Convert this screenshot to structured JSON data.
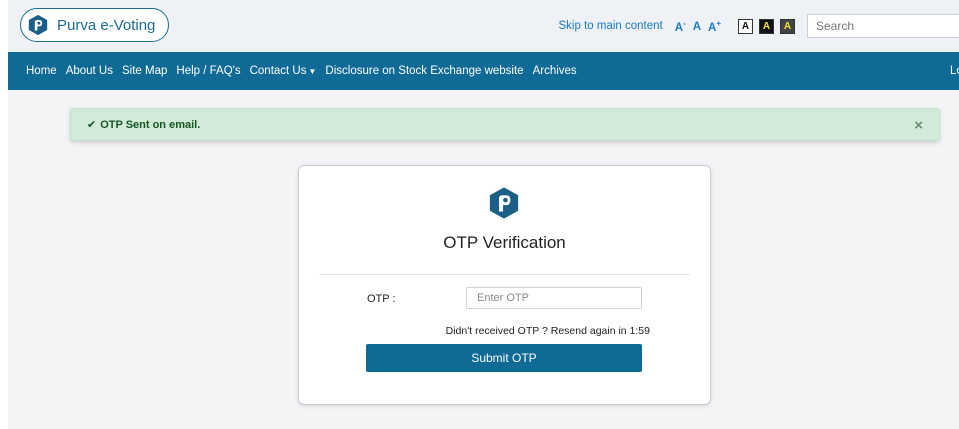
{
  "header": {
    "brand": "Purva e-Voting",
    "skip_link": "Skip to main content",
    "font_controls": {
      "decrease": "A",
      "decrease_sup": "-",
      "normal": "A",
      "increase": "A",
      "increase_sup": "+"
    },
    "contrast_options": [
      "A",
      "A",
      "A"
    ],
    "search_placeholder": "Search"
  },
  "nav": {
    "items": [
      "Home",
      "About Us",
      "Site Map",
      "Help / FAQ's",
      "Contact Us",
      "Disclosure on Stock Exchange website",
      "Archives"
    ],
    "right_item": "Lo"
  },
  "alert": {
    "message": "OTP Sent on email.",
    "close": "×"
  },
  "card": {
    "title": "OTP Verification",
    "otp_label": "OTP :",
    "otp_placeholder": "Enter OTP",
    "resend_text": "Didn't received OTP ? Resend again in 1:59",
    "submit_label": "Submit OTP"
  },
  "colors": {
    "brand": "#0f6a96",
    "alert_bg": "#d2ebd8",
    "alert_text": "#155724"
  }
}
